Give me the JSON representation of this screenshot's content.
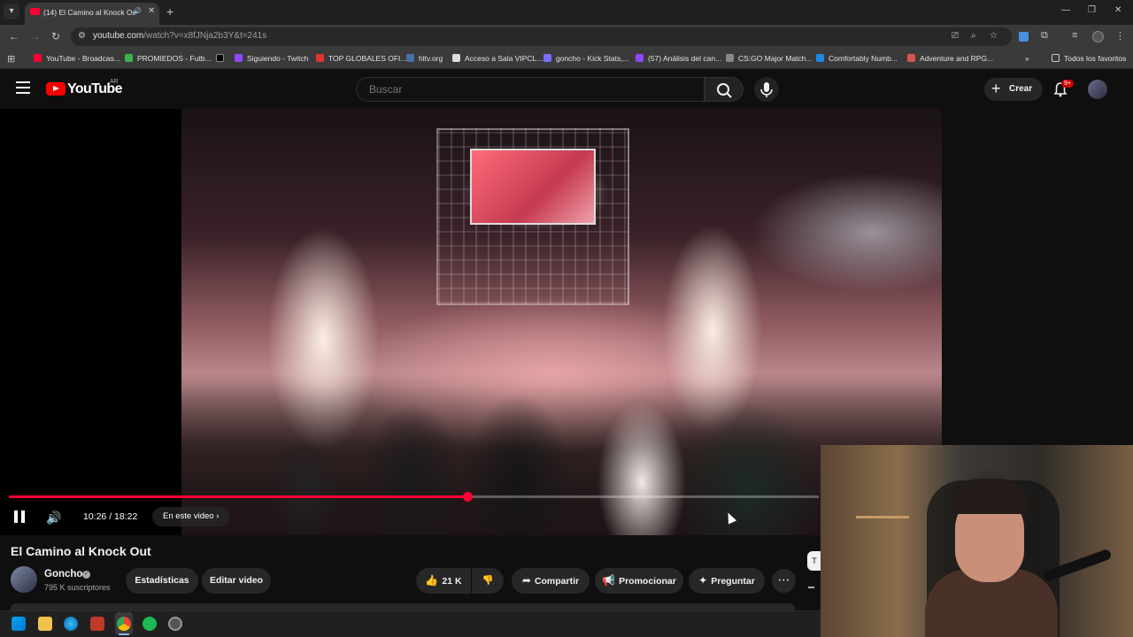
{
  "browser": {
    "tab_title": "(14) El Camino al Knock Out",
    "url_host": "youtube.com",
    "url_path": "/watch?v=x8fJNja2b3Y&t=241s",
    "bookmarks": [
      "YouTube - Broadcas...",
      "PROMIEDOS - Futb...",
      "",
      "Siguiendo - Twitch",
      "TOP GLOBALES OFI...",
      "hltv.org",
      "Acceso a Sala VIPCL...",
      "goncho - Kick Stats,...",
      "(57) Análisis del can...",
      "CS:GO Major Match...",
      "Comfortably Numb...",
      "Adventure and RPG..."
    ],
    "all_bookmarks": "Todos los favoritos",
    "icons": [
      "tab-search-icon",
      "back-icon",
      "forward-icon",
      "reload-icon",
      "site-info-icon",
      "cast-icon",
      "zoom-icon",
      "star-icon",
      "extensions-icon",
      "media-icon",
      "profile-icon",
      "kebab-menu-icon"
    ]
  },
  "youtube": {
    "logo_text": "YouTube",
    "country_code": "AR",
    "search_placeholder": "Buscar",
    "create_label": "Crear",
    "notifications_badge": "9+"
  },
  "player": {
    "current_time": "10:26",
    "duration": "18:22",
    "time_display": "10:26 / 18:22",
    "progress_fraction": 0.567,
    "chapter_label": "En este video",
    "chapter_chevron": "›"
  },
  "video": {
    "title": "El Camino al Knock Out",
    "channel": "Goncho",
    "subscribers": "795 K suscriptores",
    "stats_button": "Estadísticas",
    "edit_button": "Editar video",
    "likes": "21 K",
    "share": "Compartir",
    "promote": "Promocionar",
    "ask": "Preguntar",
    "more": "⋯",
    "side_chip": "T"
  },
  "colors": {
    "accent": "#ff0033",
    "background": "#0f0f0f",
    "pill": "#272727"
  }
}
